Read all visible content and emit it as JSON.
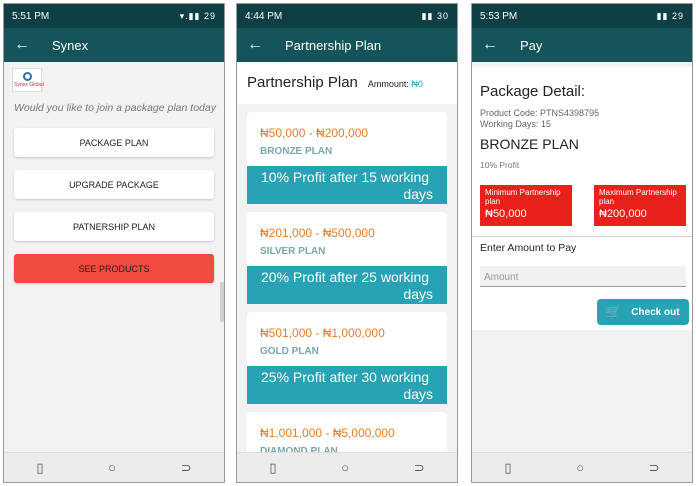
{
  "screen1": {
    "status_time": "5:51 PM",
    "status_right": "▾.▮▮ 29",
    "title": "Synex",
    "logo_text": "Synex Global",
    "question": "Would you like to join a package plan today",
    "buttons": [
      "PACKAGE PLAN",
      "UPGRADE PACKAGE",
      "PATNERSHIP PLAN",
      "SEE PRODUCTS"
    ]
  },
  "screen2": {
    "status_time": "4:44 PM",
    "status_right": "▮▮ 30",
    "title": "Partnership Plan",
    "heading": "Partnership Plan",
    "amount_label": "Ammount:",
    "amount_value": "₦0",
    "plans": [
      {
        "range": "₦50,000 - ₦200,000",
        "name": "BRONZE PLAN",
        "profit1": "10% Profit after 15 working",
        "profit2": "days"
      },
      {
        "range": "₦201,000 - ₦500,000",
        "name": "SILVER PLAN",
        "profit1": "20% Profit after 25 working",
        "profit2": "days"
      },
      {
        "range": "₦501,000 - ₦1,000,000",
        "name": "GOLD PLAN",
        "profit1": "25% Profit after 30 working",
        "profit2": "days"
      },
      {
        "range": "₦1,001,000 - ₦5,000,000",
        "name": "DIAMOND PLAN"
      }
    ]
  },
  "screen3": {
    "status_time": "5:53 PM",
    "status_right": "▮▮ 29",
    "title": "Pay",
    "detail_title": "Package Detail:",
    "product_code": "Product Code: PTNS4398795",
    "working_days": "Working Days:  15",
    "plan_name": "BRONZE PLAN",
    "profit": "10% Profit",
    "min_label": "Minimum Partnership plan",
    "min_value": "₦50,000",
    "max_label": "Maximum Partnership plan",
    "max_value": "₦200,000",
    "enter_label": "Enter Amount to Pay",
    "amount_placeholder": "Amount",
    "checkout_label": "Check out"
  },
  "nav": {
    "recent": "▯",
    "home": "○",
    "back": "⊃"
  }
}
